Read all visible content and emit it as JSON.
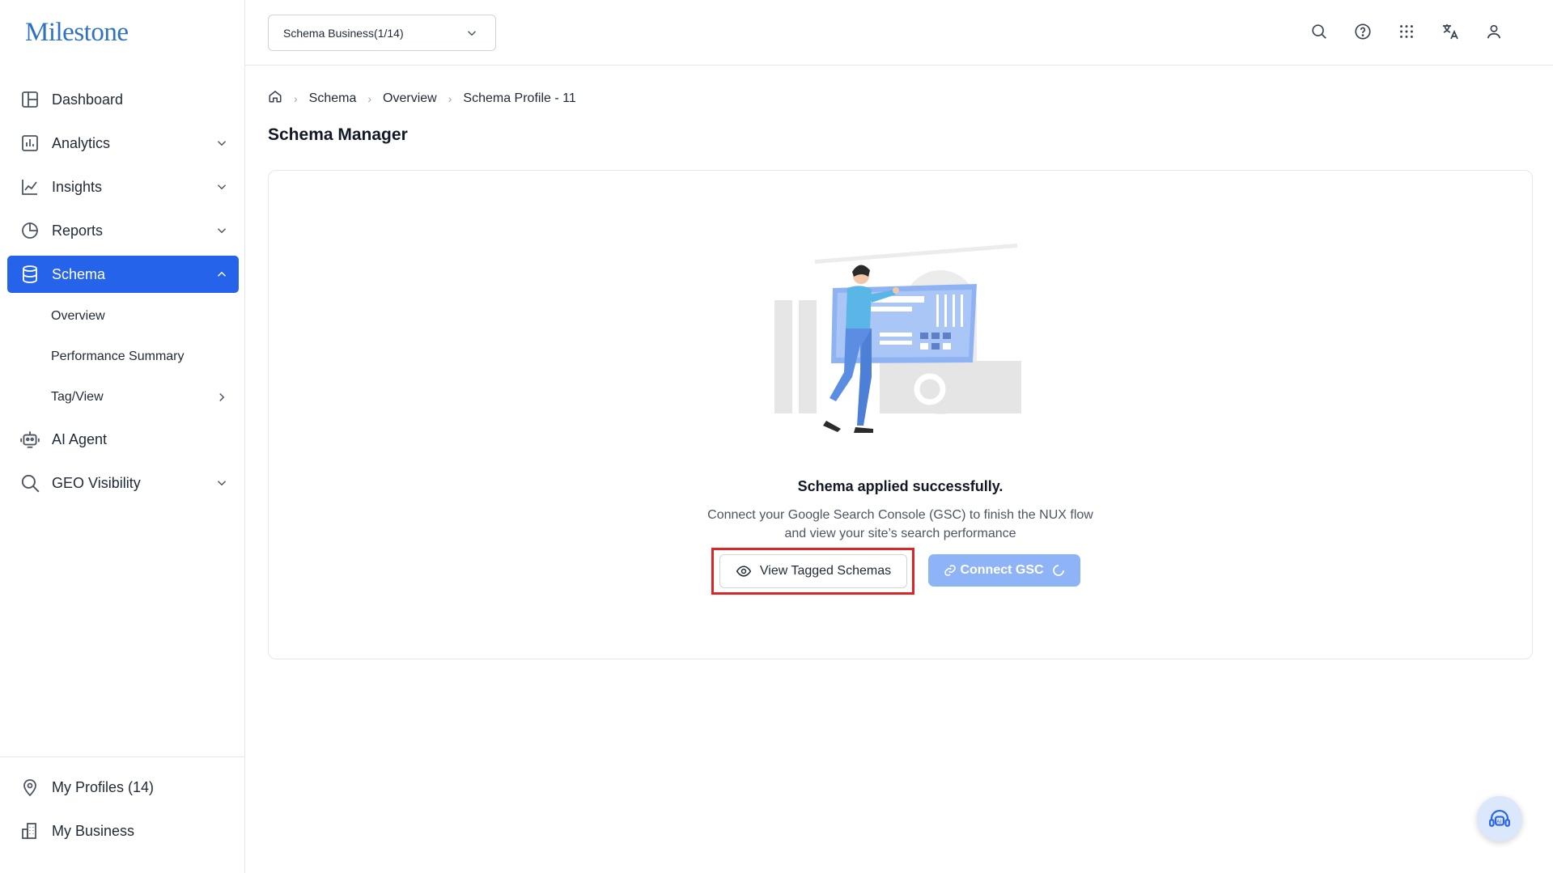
{
  "brand": {
    "logo": "Milestone"
  },
  "sidebar": {
    "items": [
      {
        "label": "Dashboard"
      },
      {
        "label": "Analytics"
      },
      {
        "label": "Insights"
      },
      {
        "label": "Reports"
      },
      {
        "label": "Schema"
      },
      {
        "label": "AI Agent"
      },
      {
        "label": "GEO Visibility"
      }
    ],
    "schema_sub": [
      {
        "label": "Overview"
      },
      {
        "label": "Performance Summary"
      },
      {
        "label": "Tag/View"
      }
    ],
    "bottom": [
      {
        "label": "My Profiles (14)"
      },
      {
        "label": "My Business"
      }
    ]
  },
  "topbar": {
    "business_select": "Schema Business(1/14)"
  },
  "breadcrumb": [
    "Schema",
    "Overview",
    "Schema Profile - 11"
  ],
  "page": {
    "title": "Schema Manager"
  },
  "status": {
    "title": "Schema applied successfully.",
    "desc_line1": "Connect your Google Search Console (GSC) to finish the NUX flow",
    "desc_line2": "and view your site’s search performance"
  },
  "buttons": {
    "view_tagged": "View Tagged Schemas",
    "connect_gsc": "Connect GSC"
  },
  "icons": {
    "fab": "ai-assistant-icon"
  },
  "colors": {
    "primary": "#2563eb",
    "connect_button": "#8fb3f7",
    "highlight": "#dc2626",
    "logo": "#2f72c4"
  }
}
